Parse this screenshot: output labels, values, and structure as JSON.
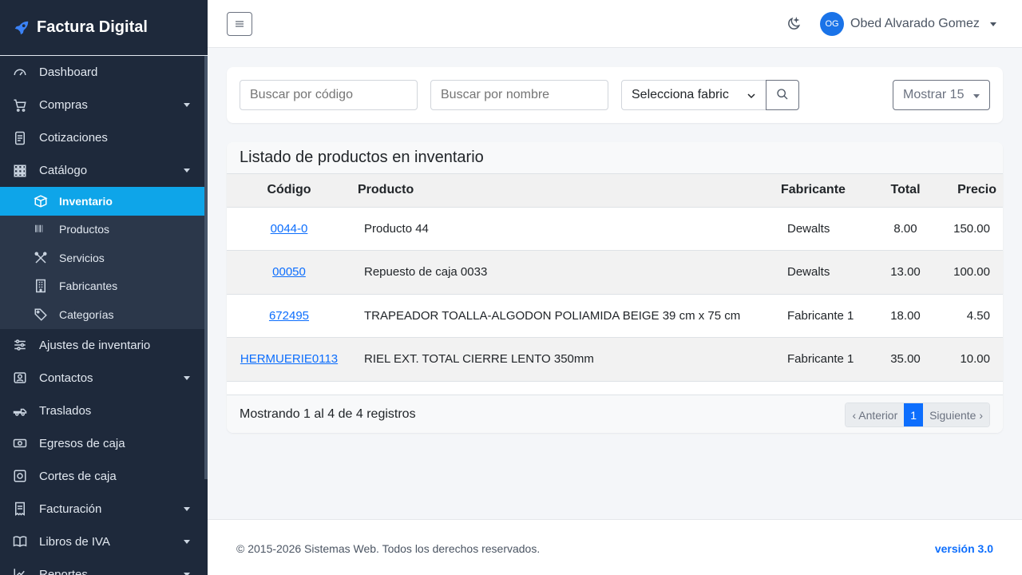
{
  "brand": {
    "name": "Factura Digital",
    "icon": "rocket-icon",
    "accent": "#0d6efd"
  },
  "sidebar": {
    "items": [
      {
        "label": "Dashboard",
        "icon": "gauge-icon"
      },
      {
        "label": "Compras",
        "icon": "cart-icon"
      },
      {
        "label": "Cotizaciones",
        "icon": "document-icon"
      },
      {
        "label": "Catálogo",
        "icon": "grid-icon"
      },
      {
        "label": "Ajustes de inventario",
        "icon": "sliders-icon"
      },
      {
        "label": "Contactos",
        "icon": "contact-card-icon"
      },
      {
        "label": "Traslados",
        "icon": "truck-icon"
      },
      {
        "label": "Egresos de caja",
        "icon": "cash-icon"
      },
      {
        "label": "Cortes de caja",
        "icon": "safe-icon"
      },
      {
        "label": "Facturación",
        "icon": "receipt-icon"
      },
      {
        "label": "Libros de IVA",
        "icon": "book-icon"
      },
      {
        "label": "Reportes",
        "icon": "chart-icon"
      }
    ],
    "submenu": [
      {
        "label": "Inventario",
        "icon": "box-icon",
        "active": true
      },
      {
        "label": "Productos",
        "icon": "barcode-icon"
      },
      {
        "label": "Servicios",
        "icon": "tools-icon"
      },
      {
        "label": "Fabricantes",
        "icon": "building-icon"
      },
      {
        "label": "Categorías",
        "icon": "tags-icon"
      }
    ],
    "active_color": "#0ea5e9"
  },
  "topbar": {
    "avatar_initials": "OG",
    "user_name": "Obed Alvarado Gomez"
  },
  "filters": {
    "code_placeholder": "Buscar por código",
    "name_placeholder": "Buscar por nombre",
    "manufacturer_select": "Selecciona fabric",
    "show_label": "Mostrar 15"
  },
  "table": {
    "title": "Listado de productos en inventario",
    "headers": {
      "code": "Código",
      "product": "Producto",
      "manufacturer": "Fabricante",
      "total": "Total",
      "price": "Precio"
    },
    "rows": [
      {
        "code": "0044-0",
        "product": "Producto 44",
        "manufacturer": "Dewalts",
        "total": "8.00",
        "price": "150.00"
      },
      {
        "code": "00050",
        "product": "Repuesto de caja 0033",
        "manufacturer": "Dewalts",
        "total": "13.00",
        "price": "100.00"
      },
      {
        "code": "672495",
        "product": "TRAPEADOR TOALLA-ALGODON POLIAMIDA BEIGE 39 cm x 75 cm",
        "manufacturer": "Fabricante 1",
        "total": "18.00",
        "price": "4.50"
      },
      {
        "code": "HERMUERIE0113",
        "product": "RIEL EXT. TOTAL CIERRE LENTO 350mm",
        "manufacturer": "Fabricante 1",
        "total": "35.00",
        "price": "10.00"
      }
    ],
    "summary": "Mostrando 1 al 4 de 4 registros",
    "pagination": {
      "prev": "‹ Anterior",
      "current": "1",
      "next": "Siguiente ›"
    }
  },
  "footer": {
    "copyright": "© 2015-2026 Sistemas Web. Todos los derechos reservados.",
    "version": "versión 3.0"
  }
}
